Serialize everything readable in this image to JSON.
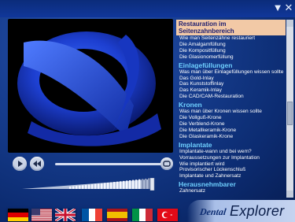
{
  "window": {
    "minimize_icon": "triangle-down-icon",
    "close_icon": "x-icon"
  },
  "toc": {
    "sections": [
      {
        "title": "Restauration im Seitenzahnbereich",
        "active": true,
        "items": [
          "Wie man Seitenzähne restauriert",
          "Die Amalgamfüllung",
          "Die Kompositfüllung",
          "Die Glasionomerfüllung"
        ]
      },
      {
        "title": "Einlagefüllungen",
        "active": false,
        "items": [
          "Was man über Einlagefüllungen wissen sollte",
          "Das Gold-Inlay",
          "Das Kunststoffinlay",
          "Das Keramik-Inlay",
          "Die CAD/CAM-Restauration"
        ]
      },
      {
        "title": "Kronen",
        "active": false,
        "items": [
          "Was man über Kronen wissen sollte",
          "Die Vollguß-Krone",
          "Die Verblend-Krone",
          "Die Metallkeramik-Krone",
          "Die Glaskeramik-Krone"
        ]
      },
      {
        "title": "Implantate",
        "active": false,
        "items": [
          "Implantate-wann und bei wem?",
          "Vorraussetzungen zur Implantation",
          "Wie implantiert wird",
          "Provisorischer Lückenschluß",
          "Implantate und Zahnersatz"
        ]
      },
      {
        "title": "Herausnehmbarer",
        "active": false,
        "items": [
          "Zahnersatz"
        ]
      }
    ]
  },
  "player": {
    "play_icon": "play-icon",
    "rewind_icon": "rewind-icon",
    "loop_icon": "loop-icon",
    "progress": 0.0
  },
  "volume": {
    "level": 0.85
  },
  "flags": [
    "de-flag-icon",
    "us-flag-icon",
    "uk-flag-icon",
    "fr-flag-icon",
    "es-flag-icon",
    "it-flag-icon",
    "tr-flag-icon"
  ],
  "logo": {
    "part1": "Dental",
    "part2": "Explorer"
  }
}
